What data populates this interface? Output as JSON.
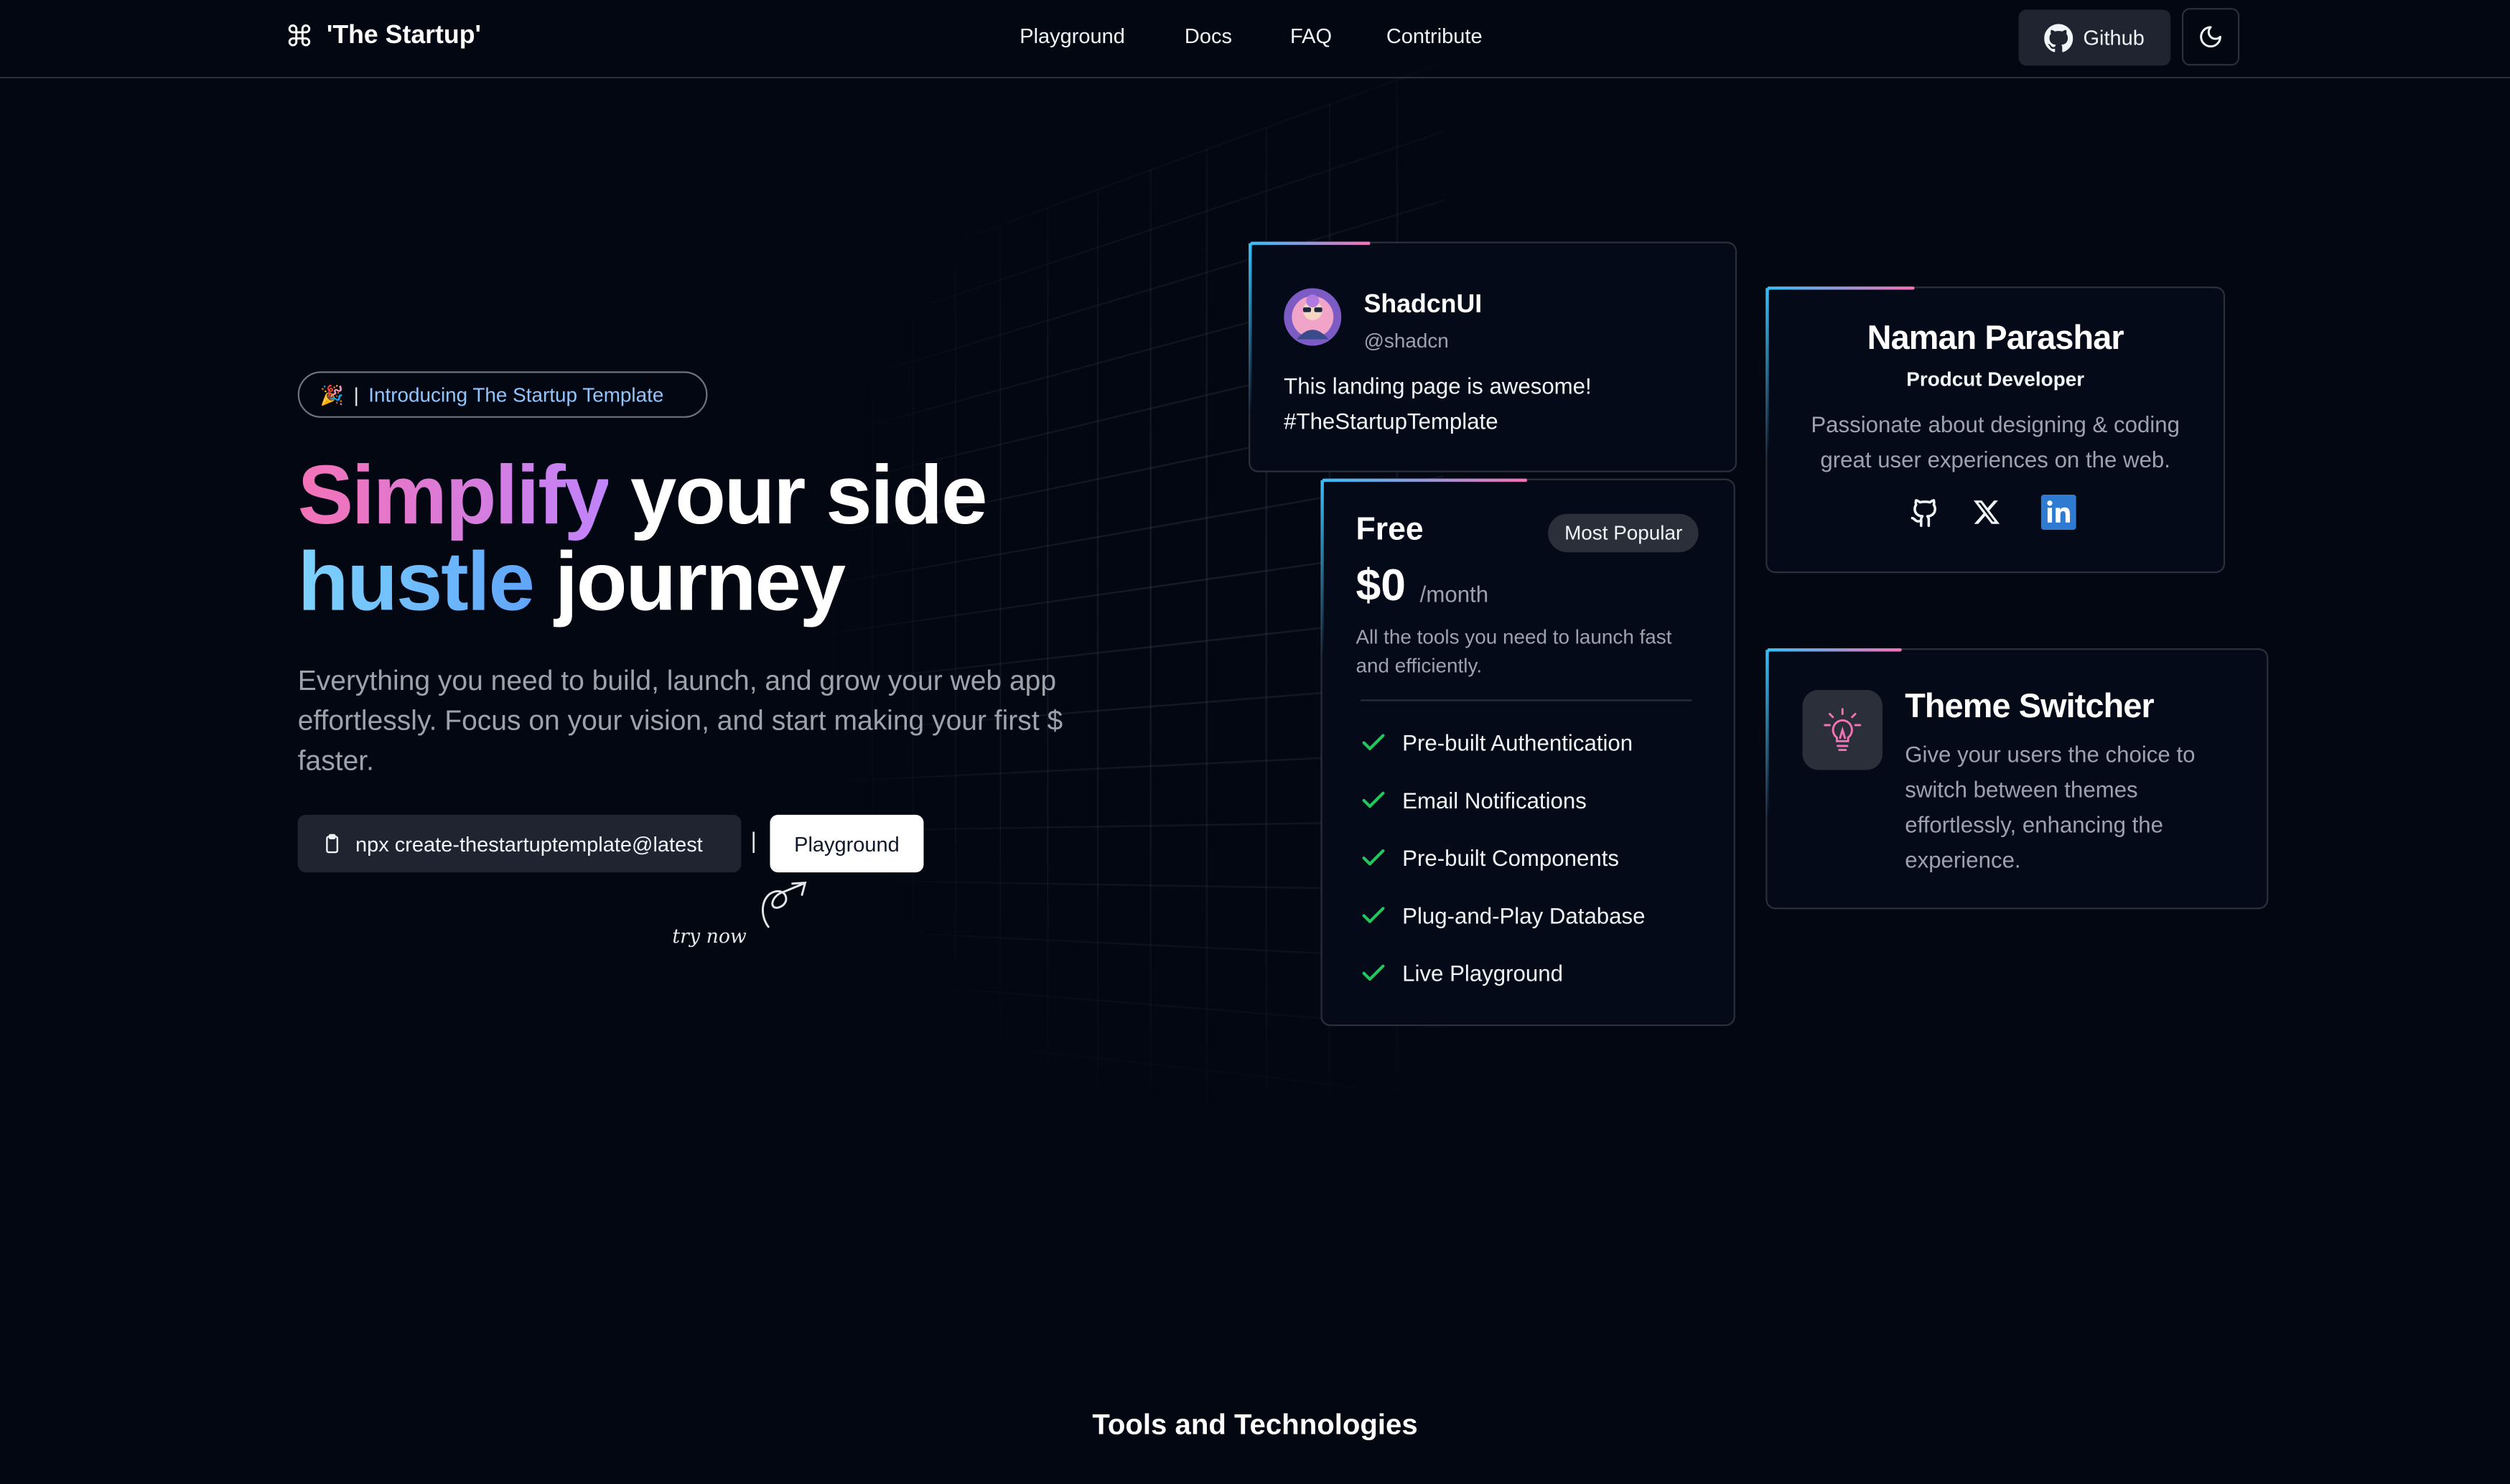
{
  "navbar": {
    "brand_name": "'The Startup'",
    "links": [
      "Playground",
      "Docs",
      "FAQ",
      "Contribute"
    ],
    "github_label": "Github"
  },
  "hero": {
    "badge_emoji": "🎉",
    "badge_text": "Introducing The Startup Template",
    "headline_word1": "Simplify",
    "headline_part1": " your side",
    "headline_word2": "hustle",
    "headline_part2": " journey",
    "subtext": "Everything you need to build, launch, and grow your web app effortlessly. Focus on your vision, and start making your first $ faster.",
    "npx_command": "npx create-thestartuptemplate@latest",
    "divider": "|",
    "playground_label": "Playground",
    "try_now": "try now"
  },
  "testimonial": {
    "name": "ShadcnUI",
    "handle": "@shadcn",
    "body_line1": "This landing page is awesome!",
    "body_line2": "#TheStartupTemplate"
  },
  "pricing": {
    "plan": "Free",
    "badge": "Most Popular",
    "price": "$0",
    "period": "/month",
    "description": "All the tools you need to launch fast and efficiently.",
    "features": [
      "Pre-built Authentication",
      "Email Notifications",
      "Pre-built Components",
      "Plug-and-Play Database",
      "Live Playground"
    ]
  },
  "profile": {
    "name": "Naman Parashar",
    "role": "Prodcut Developer",
    "bio": "Passionate about designing & coding great user experiences on the web."
  },
  "feature": {
    "title": "Theme Switcher",
    "body": "Give your users the choice to switch between themes effortlessly, enhancing the experience."
  },
  "sections": {
    "tools_title": "Tools and Technologies"
  },
  "colors": {
    "background": "#030712",
    "accent_pink": "#f472b6",
    "accent_blue": "#7dd3fc",
    "check_green": "#22c55e"
  },
  "icons": {
    "brand": "command-icon",
    "github": "github-icon",
    "theme": "moon-icon",
    "clipboard": "clipboard-icon",
    "check": "check-icon",
    "x": "x-icon",
    "linkedin": "linkedin-icon",
    "feature": "lightbulb-icon"
  }
}
